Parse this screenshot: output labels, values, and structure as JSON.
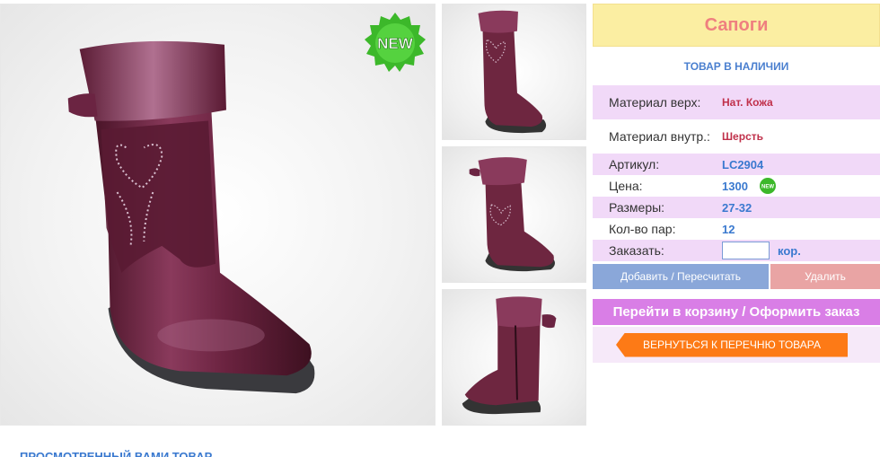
{
  "product": {
    "title": "Сапоги",
    "availability": "ТОВАР В НАЛИЧИИ",
    "badge": "NEW",
    "badge_mini": "NEW",
    "specs": [
      {
        "label": "Материал верх:",
        "value": "Нат. Кожа"
      },
      {
        "label": "Материал внутр.:",
        "value": "Шерсть"
      },
      {
        "label": "Артикул:",
        "value": "LC2904"
      },
      {
        "label": "Цена:",
        "value": "1300"
      },
      {
        "label": "Размеры:",
        "value": "27-32"
      },
      {
        "label": "Кол-во пар:",
        "value": "12"
      }
    ],
    "order": {
      "label": "Заказать:",
      "value": "",
      "unit": "кор."
    }
  },
  "actions": {
    "add": "Добавить / Пересчитать",
    "delete": "Удалить",
    "cart": "Перейти в корзину / Оформить заказ",
    "back": "ВЕРНУТЬСЯ К ПЕРЕЧНЮ ТОВАРА"
  },
  "section": {
    "viewed": "ПРОСМОТРЕННЫЙ ВАМИ ТОВАР"
  },
  "colors": {
    "boot": "#6e2640",
    "title_bg": "#fbeea2",
    "title_text": "#ef7f7f",
    "accent_blue": "#3a79cf",
    "accent_red": "#c0304a",
    "spec_pink": "#f1d9f8",
    "add_button": "#8aa7d9",
    "delete_button": "#e9a4a4",
    "cart_button": "#d97ee6",
    "back_button": "#fd7a16",
    "badge": "#3cb82a"
  }
}
